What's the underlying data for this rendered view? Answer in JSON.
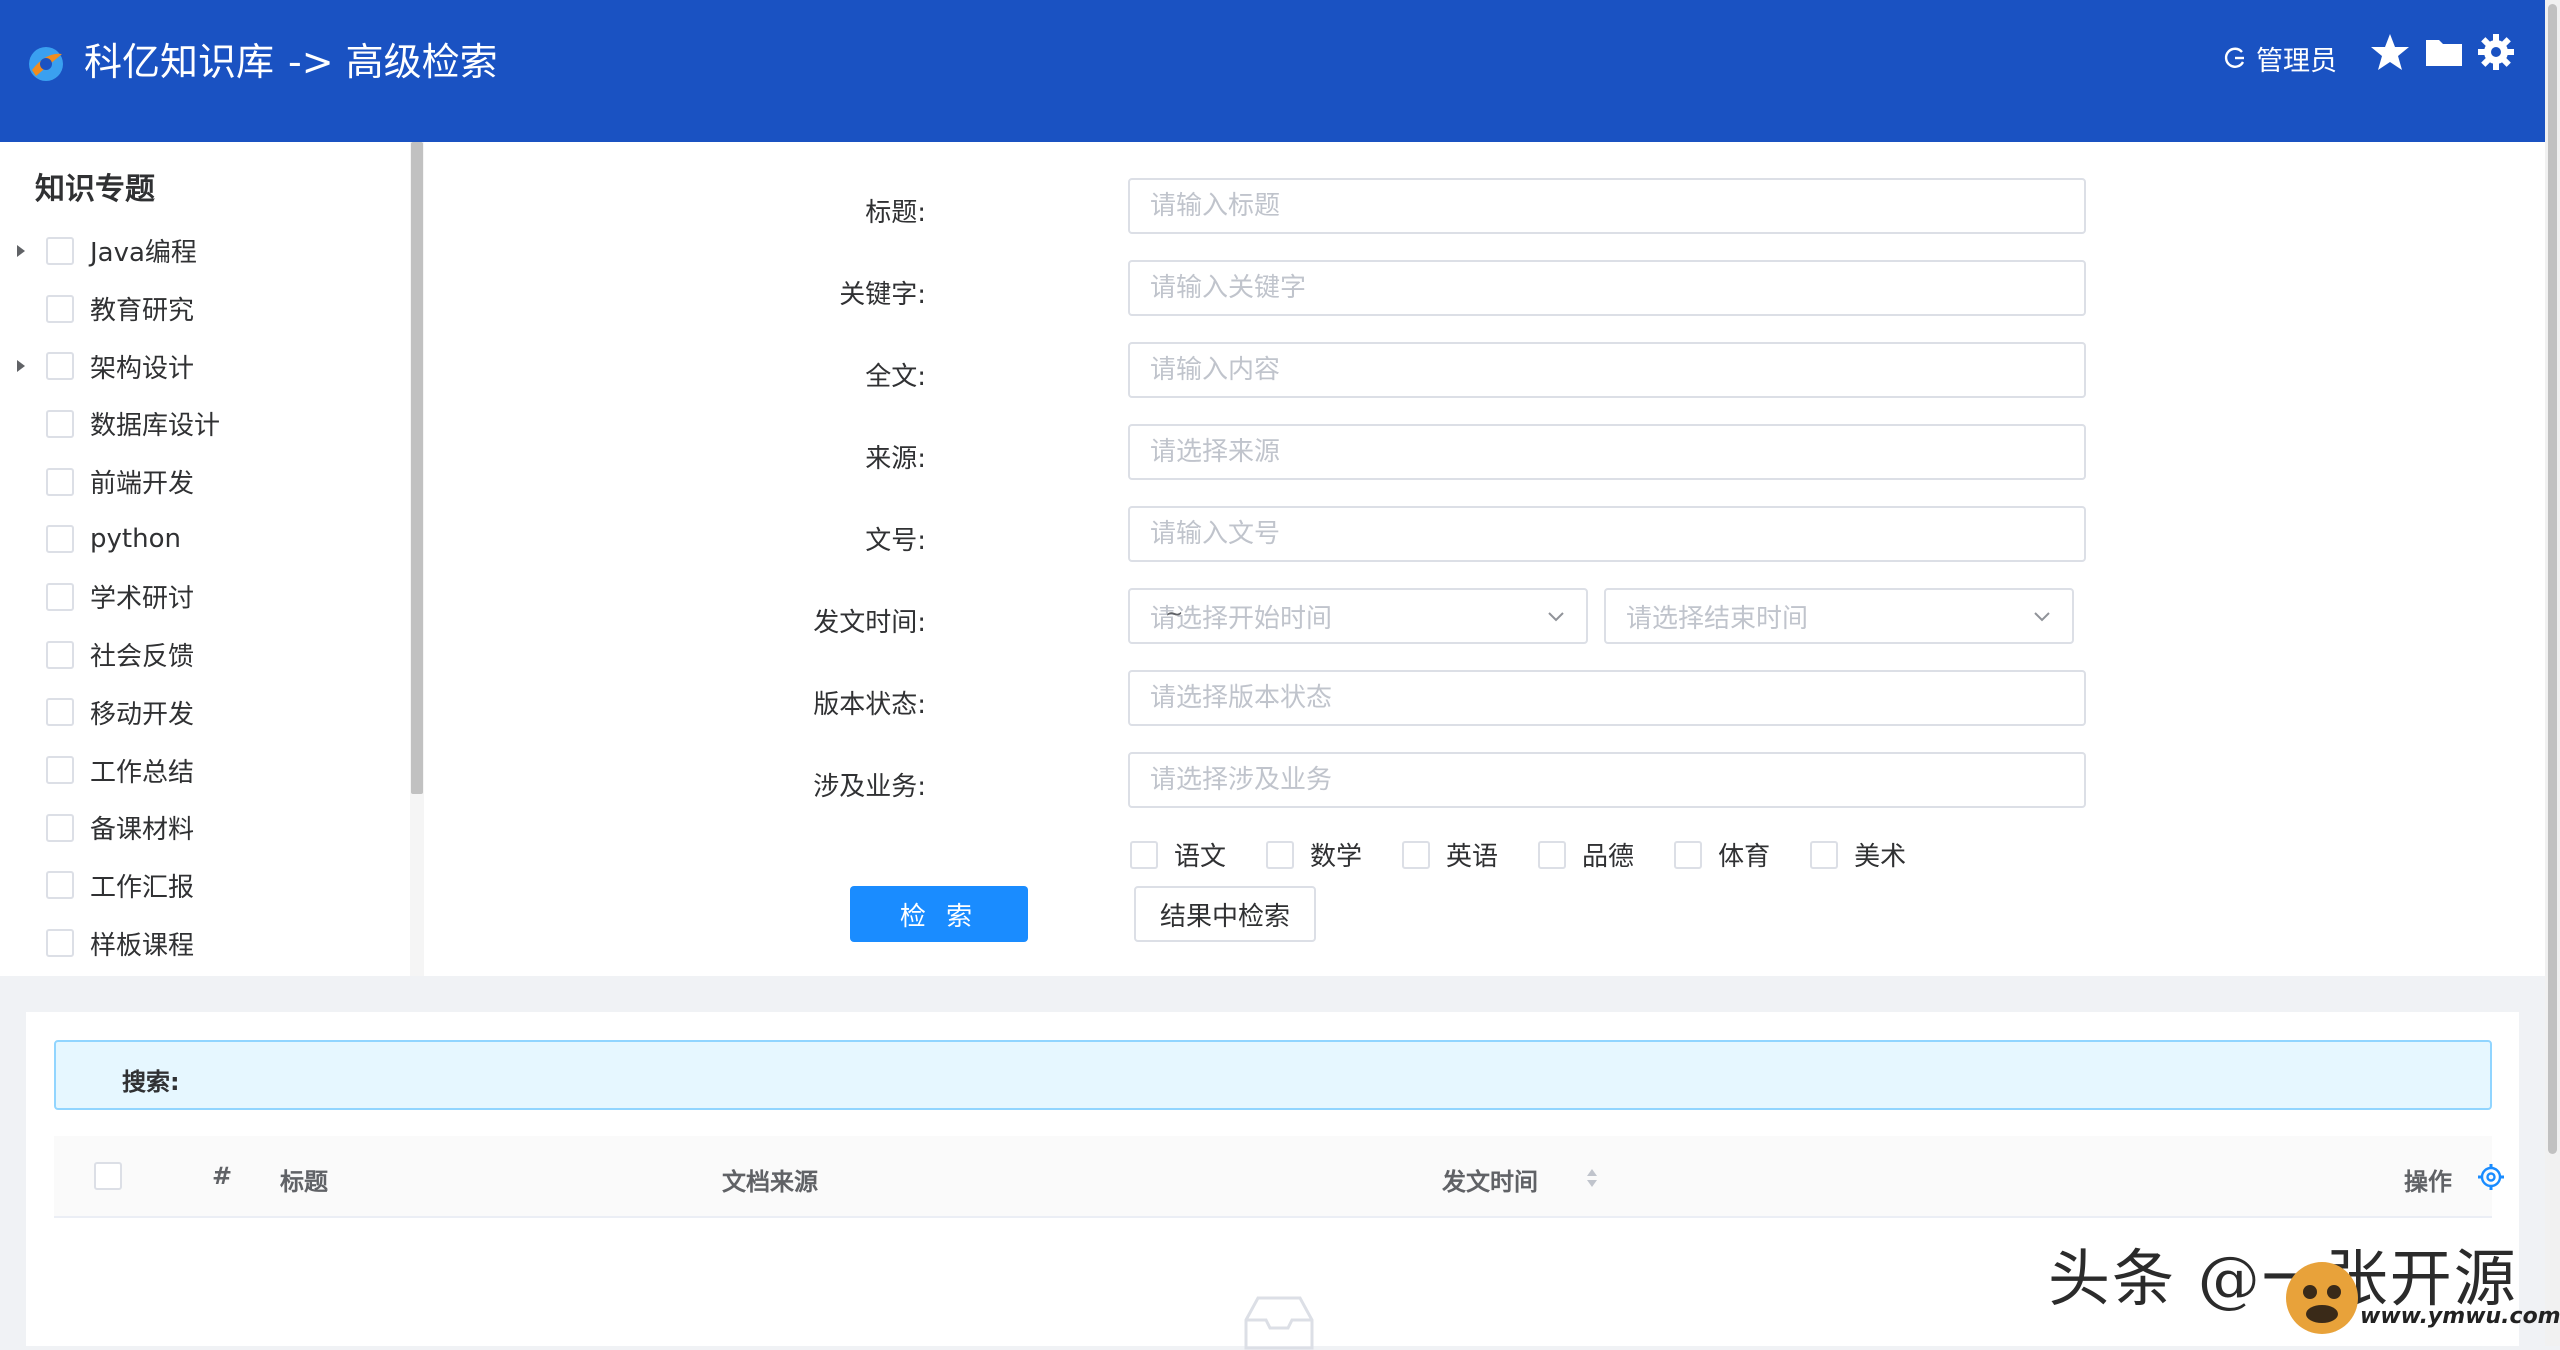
{
  "header": {
    "app_title": "科亿知识库",
    "page_title": "-> 高级检索",
    "user_label": "管理员",
    "icons": [
      "logo-icon",
      "logout-icon",
      "star-icon",
      "folder-icon",
      "gear-icon"
    ]
  },
  "colors": {
    "header_bg": "#1a52c2",
    "primary": "#1a8cff",
    "info_bg": "#e6f7ff"
  },
  "sidebar": {
    "title": "知识专题",
    "items": [
      {
        "label": "Java编程",
        "has_children": true
      },
      {
        "label": "教育研究",
        "has_children": false
      },
      {
        "label": "架构设计",
        "has_children": true
      },
      {
        "label": "数据库设计",
        "has_children": false
      },
      {
        "label": "前端开发",
        "has_children": false
      },
      {
        "label": "python",
        "has_children": false
      },
      {
        "label": "学术研讨",
        "has_children": false
      },
      {
        "label": "社会反馈",
        "has_children": false
      },
      {
        "label": "移动开发",
        "has_children": false
      },
      {
        "label": "工作总结",
        "has_children": false
      },
      {
        "label": "备课材料",
        "has_children": false
      },
      {
        "label": "工作汇报",
        "has_children": false
      },
      {
        "label": "样板课程",
        "has_children": false
      }
    ]
  },
  "form": {
    "title": {
      "label": "标题:",
      "placeholder": "请输入标题"
    },
    "keyword": {
      "label": "关键字:",
      "placeholder": "请输入关键字"
    },
    "fulltext": {
      "label": "全文:",
      "placeholder": "请输入内容"
    },
    "source": {
      "label": "来源:",
      "placeholder": "请选择来源"
    },
    "doc_no": {
      "label": "文号:",
      "placeholder": "请输入文号"
    },
    "date": {
      "label": "发文时间:",
      "start_placeholder": "请选择开始时间",
      "separator": "~",
      "end_placeholder": "请选择结束时间"
    },
    "version": {
      "label": "版本状态:",
      "placeholder": "请选择版本状态"
    },
    "business": {
      "label": "涉及业务:",
      "placeholder": "请选择涉及业务"
    },
    "subjects": [
      "语文",
      "数学",
      "英语",
      "品德",
      "体育",
      "美术"
    ],
    "search_button": "检 索",
    "search_in_results_button": "结果中检索"
  },
  "results": {
    "search_label": "搜索:",
    "columns": {
      "index": "#",
      "title": "标题",
      "source": "文档来源",
      "date": "发文时间",
      "action": "操作"
    }
  },
  "watermark": {
    "text": "头条 @一张开源",
    "sub": "www.ymwu.com"
  }
}
